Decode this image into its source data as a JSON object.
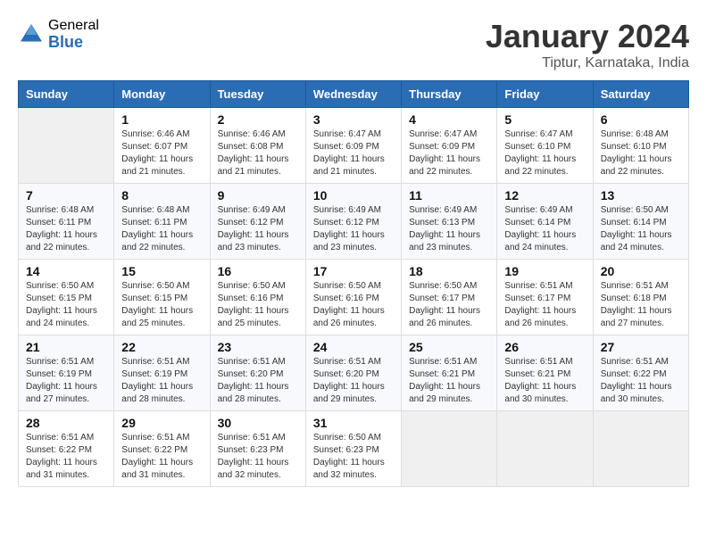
{
  "header": {
    "logo_general": "General",
    "logo_blue": "Blue",
    "month_title": "January 2024",
    "location": "Tiptur, Karnataka, India"
  },
  "columns": [
    "Sunday",
    "Monday",
    "Tuesday",
    "Wednesday",
    "Thursday",
    "Friday",
    "Saturday"
  ],
  "weeks": [
    [
      {
        "day": "",
        "info": ""
      },
      {
        "day": "1",
        "info": "Sunrise: 6:46 AM\nSunset: 6:07 PM\nDaylight: 11 hours\nand 21 minutes."
      },
      {
        "day": "2",
        "info": "Sunrise: 6:46 AM\nSunset: 6:08 PM\nDaylight: 11 hours\nand 21 minutes."
      },
      {
        "day": "3",
        "info": "Sunrise: 6:47 AM\nSunset: 6:09 PM\nDaylight: 11 hours\nand 21 minutes."
      },
      {
        "day": "4",
        "info": "Sunrise: 6:47 AM\nSunset: 6:09 PM\nDaylight: 11 hours\nand 22 minutes."
      },
      {
        "day": "5",
        "info": "Sunrise: 6:47 AM\nSunset: 6:10 PM\nDaylight: 11 hours\nand 22 minutes."
      },
      {
        "day": "6",
        "info": "Sunrise: 6:48 AM\nSunset: 6:10 PM\nDaylight: 11 hours\nand 22 minutes."
      }
    ],
    [
      {
        "day": "7",
        "info": "Sunrise: 6:48 AM\nSunset: 6:11 PM\nDaylight: 11 hours\nand 22 minutes."
      },
      {
        "day": "8",
        "info": "Sunrise: 6:48 AM\nSunset: 6:11 PM\nDaylight: 11 hours\nand 22 minutes."
      },
      {
        "day": "9",
        "info": "Sunrise: 6:49 AM\nSunset: 6:12 PM\nDaylight: 11 hours\nand 23 minutes."
      },
      {
        "day": "10",
        "info": "Sunrise: 6:49 AM\nSunset: 6:12 PM\nDaylight: 11 hours\nand 23 minutes."
      },
      {
        "day": "11",
        "info": "Sunrise: 6:49 AM\nSunset: 6:13 PM\nDaylight: 11 hours\nand 23 minutes."
      },
      {
        "day": "12",
        "info": "Sunrise: 6:49 AM\nSunset: 6:14 PM\nDaylight: 11 hours\nand 24 minutes."
      },
      {
        "day": "13",
        "info": "Sunrise: 6:50 AM\nSunset: 6:14 PM\nDaylight: 11 hours\nand 24 minutes."
      }
    ],
    [
      {
        "day": "14",
        "info": "Sunrise: 6:50 AM\nSunset: 6:15 PM\nDaylight: 11 hours\nand 24 minutes."
      },
      {
        "day": "15",
        "info": "Sunrise: 6:50 AM\nSunset: 6:15 PM\nDaylight: 11 hours\nand 25 minutes."
      },
      {
        "day": "16",
        "info": "Sunrise: 6:50 AM\nSunset: 6:16 PM\nDaylight: 11 hours\nand 25 minutes."
      },
      {
        "day": "17",
        "info": "Sunrise: 6:50 AM\nSunset: 6:16 PM\nDaylight: 11 hours\nand 26 minutes."
      },
      {
        "day": "18",
        "info": "Sunrise: 6:50 AM\nSunset: 6:17 PM\nDaylight: 11 hours\nand 26 minutes."
      },
      {
        "day": "19",
        "info": "Sunrise: 6:51 AM\nSunset: 6:17 PM\nDaylight: 11 hours\nand 26 minutes."
      },
      {
        "day": "20",
        "info": "Sunrise: 6:51 AM\nSunset: 6:18 PM\nDaylight: 11 hours\nand 27 minutes."
      }
    ],
    [
      {
        "day": "21",
        "info": "Sunrise: 6:51 AM\nSunset: 6:19 PM\nDaylight: 11 hours\nand 27 minutes."
      },
      {
        "day": "22",
        "info": "Sunrise: 6:51 AM\nSunset: 6:19 PM\nDaylight: 11 hours\nand 28 minutes."
      },
      {
        "day": "23",
        "info": "Sunrise: 6:51 AM\nSunset: 6:20 PM\nDaylight: 11 hours\nand 28 minutes."
      },
      {
        "day": "24",
        "info": "Sunrise: 6:51 AM\nSunset: 6:20 PM\nDaylight: 11 hours\nand 29 minutes."
      },
      {
        "day": "25",
        "info": "Sunrise: 6:51 AM\nSunset: 6:21 PM\nDaylight: 11 hours\nand 29 minutes."
      },
      {
        "day": "26",
        "info": "Sunrise: 6:51 AM\nSunset: 6:21 PM\nDaylight: 11 hours\nand 30 minutes."
      },
      {
        "day": "27",
        "info": "Sunrise: 6:51 AM\nSunset: 6:22 PM\nDaylight: 11 hours\nand 30 minutes."
      }
    ],
    [
      {
        "day": "28",
        "info": "Sunrise: 6:51 AM\nSunset: 6:22 PM\nDaylight: 11 hours\nand 31 minutes."
      },
      {
        "day": "29",
        "info": "Sunrise: 6:51 AM\nSunset: 6:22 PM\nDaylight: 11 hours\nand 31 minutes."
      },
      {
        "day": "30",
        "info": "Sunrise: 6:51 AM\nSunset: 6:23 PM\nDaylight: 11 hours\nand 32 minutes."
      },
      {
        "day": "31",
        "info": "Sunrise: 6:50 AM\nSunset: 6:23 PM\nDaylight: 11 hours\nand 32 minutes."
      },
      {
        "day": "",
        "info": ""
      },
      {
        "day": "",
        "info": ""
      },
      {
        "day": "",
        "info": ""
      }
    ]
  ]
}
